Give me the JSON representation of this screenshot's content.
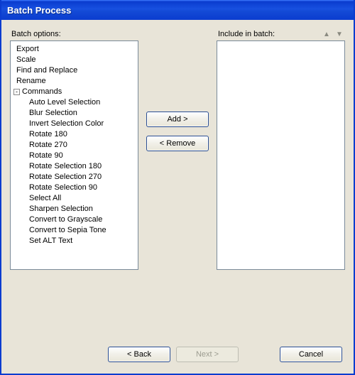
{
  "window": {
    "title": "Batch Process"
  },
  "left": {
    "label": "Batch options:",
    "items": [
      "Export",
      "Scale",
      "Find and Replace",
      "Rename"
    ],
    "commands_label": "Commands",
    "commands_expander_glyph": "-",
    "commands": [
      "Auto Level Selection",
      "Blur Selection",
      "Invert Selection Color",
      "Rotate 180",
      "Rotate 270",
      "Rotate 90",
      "Rotate Selection 180",
      "Rotate Selection 270",
      "Rotate Selection 90",
      "Select All",
      "Sharpen Selection",
      "Convert to Grayscale",
      "Convert to Sepia Tone",
      "Set ALT Text"
    ]
  },
  "mid": {
    "add_label": "Add >",
    "remove_label": "< Remove"
  },
  "right": {
    "label": "Include in batch:",
    "up_glyph": "▲",
    "down_glyph": "▼"
  },
  "footer": {
    "back_label": "< Back",
    "next_label": "Next  >",
    "cancel_label": "Cancel"
  }
}
